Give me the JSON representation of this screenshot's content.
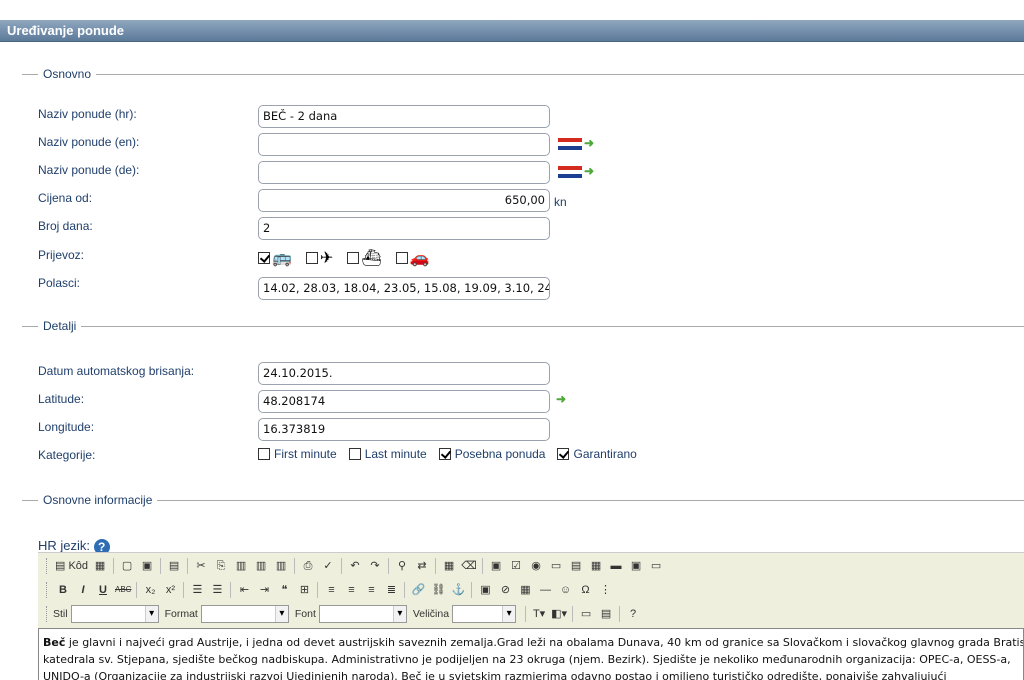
{
  "header": {
    "title": "Uređivanje ponude"
  },
  "sections": {
    "basic": "Osnovno",
    "details": "Detalji",
    "info": "Osnovne informacije"
  },
  "fields": {
    "name_hr": {
      "label": "Naziv ponude (hr):",
      "value": "BEČ - 2 dana"
    },
    "name_en": {
      "label": "Naziv ponude (en):",
      "value": ""
    },
    "name_de": {
      "label": "Naziv ponude (de):",
      "value": ""
    },
    "price": {
      "label": "Cijena od:",
      "value": "650,00",
      "unit": "kn"
    },
    "days": {
      "label": "Broj dana:",
      "value": "2"
    },
    "transport": {
      "label": "Prijevoz:",
      "options": [
        {
          "icon": "bus-icon",
          "checked": true
        },
        {
          "icon": "plane-icon",
          "checked": false
        },
        {
          "icon": "ship-icon",
          "checked": false
        },
        {
          "icon": "car-icon",
          "checked": false
        }
      ]
    },
    "departures": {
      "label": "Polasci:",
      "value": "14.02, 28.03, 18.04, 23.05, 15.08, 19.09, 3.10, 24"
    },
    "delete_date": {
      "label": "Datum automatskog brisanja:",
      "value": "24.10.2015."
    },
    "latitude": {
      "label": "Latitude:",
      "value": "48.208174"
    },
    "longitude": {
      "label": "Longitude:",
      "value": "16.373819"
    },
    "categories": {
      "label": "Kategorije:",
      "options": [
        {
          "label": "First minute",
          "checked": false
        },
        {
          "label": "Last minute",
          "checked": false
        },
        {
          "label": "Posebna ponuda",
          "checked": true
        },
        {
          "label": "Garantirano",
          "checked": true
        }
      ]
    }
  },
  "editor": {
    "label": "HR jezik:",
    "code_button": "Kôd",
    "combos": {
      "style": "Stil",
      "format": "Format",
      "font": "Font",
      "size": "Veličina"
    },
    "content_lead": "Beč",
    "content_line1": " je glavni i najveći grad Austrije, i jedna od devet austrijskih saveznih zemalja.Grad leži na obalama Dunava, 40 km od granice sa Slovačkom i slovačkog glavnog grada Bratislave.",
    "content_line2": "katedrala sv. Stjepana, sjedište bečkog nadbiskupa. Administrativno je podijeljen na 23 okruga (njem. Bezirk). Sjedište je nekoliko međunarodnih organizacija: OPEC-a, OESS-a,",
    "content_line3": "UNIDO-a (Organizacije za industrijski razvoj Ujedinjenih naroda). Beč je u svjetskim razmjerima odavno postao i omiljeno turističko odredište, ponajviše zahvaljujući"
  }
}
